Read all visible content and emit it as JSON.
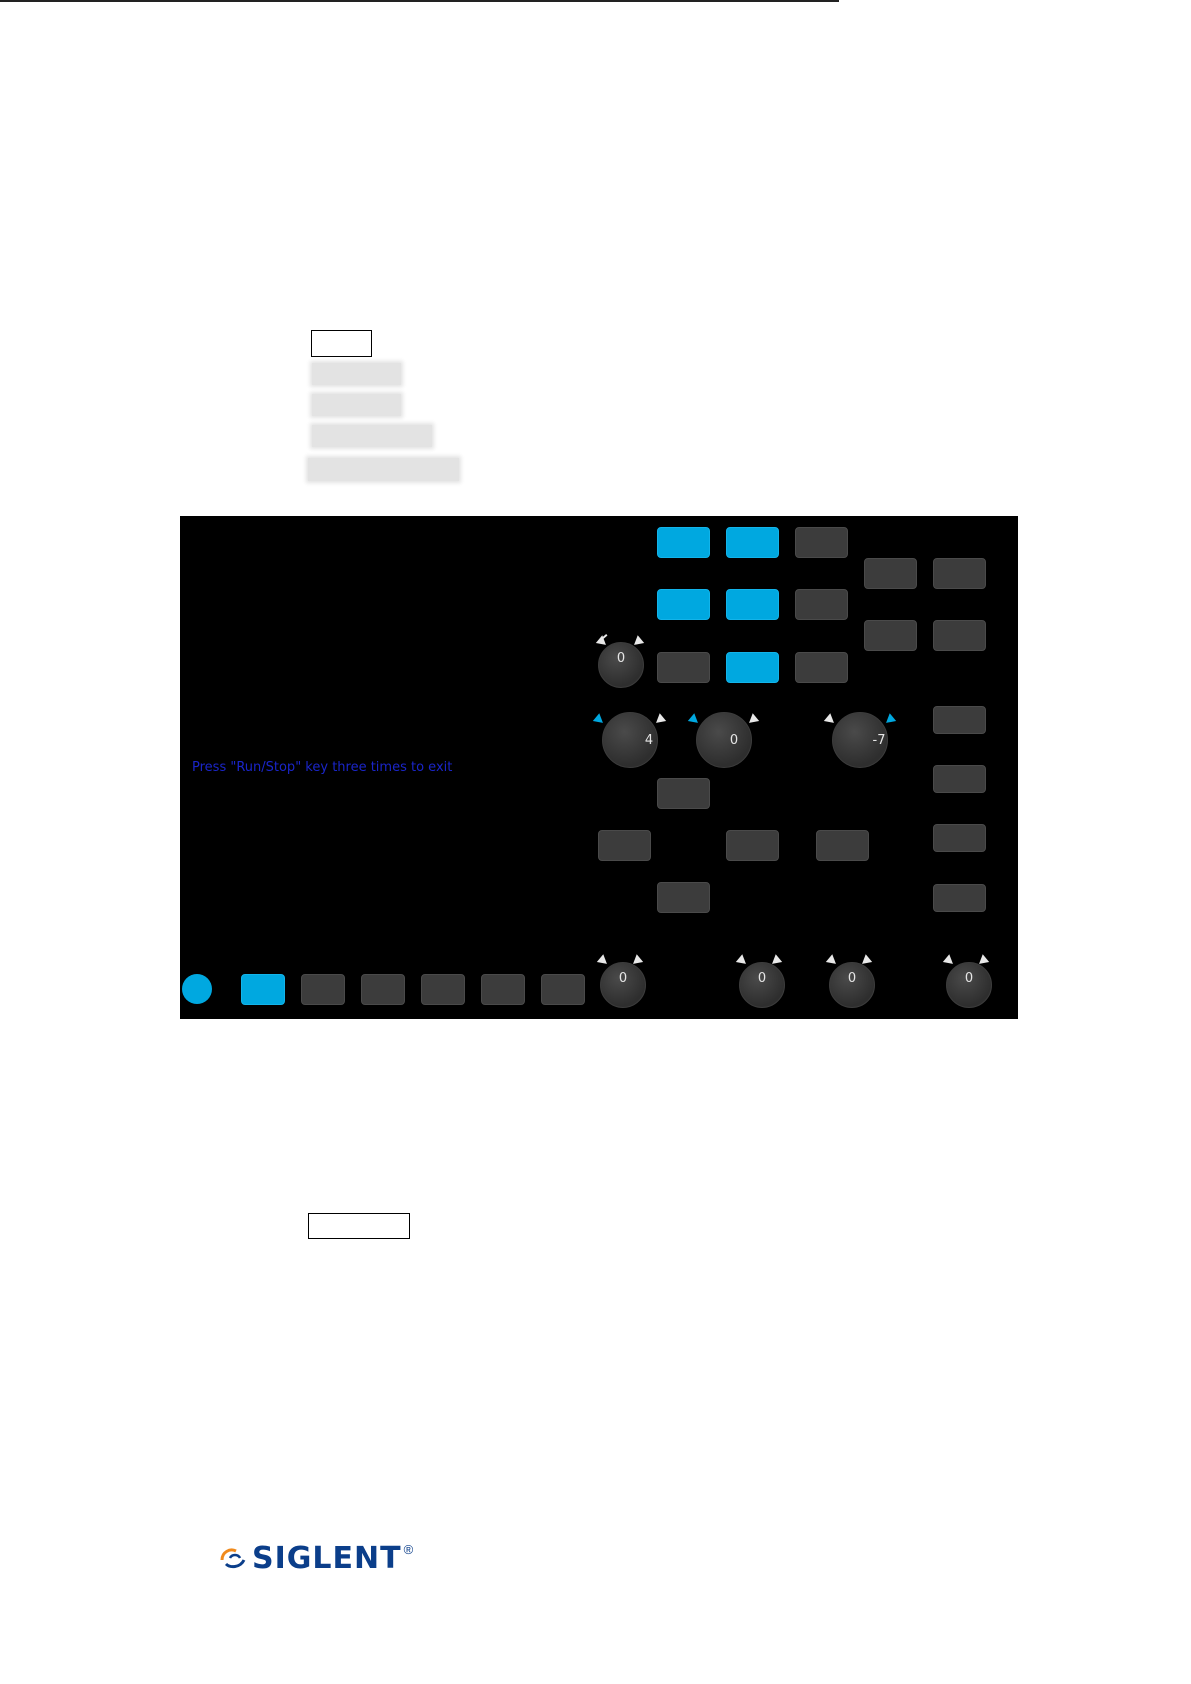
{
  "screen": {
    "exit_message": "Press \"Run/Stop\" key three times to exit",
    "accent_color": "#00a8e0",
    "message_color": "#1a25c8",
    "knobs": [
      {
        "value": "0"
      },
      {
        "value": "4"
      },
      {
        "value": "0"
      },
      {
        "value": "-7"
      },
      {
        "value": "0"
      },
      {
        "value": "0"
      },
      {
        "value": "0"
      },
      {
        "value": "0"
      }
    ]
  },
  "logo": {
    "text": "SIGLENT",
    "registered": "®"
  }
}
